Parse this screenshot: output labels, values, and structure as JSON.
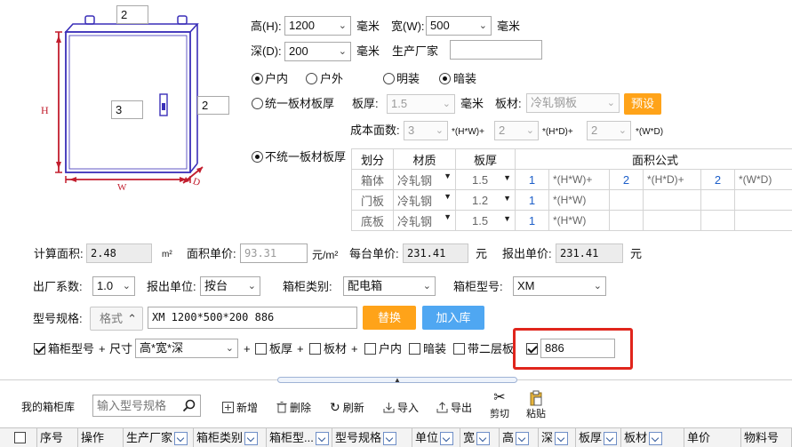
{
  "diagram": {
    "top_value": "2",
    "front_value": "3",
    "side_value": "2",
    "h_label": "H",
    "w_label": "W",
    "d_label": "D"
  },
  "dims": {
    "height_label": "高(H):",
    "height_value": "1200",
    "width_label": "宽(W):",
    "width_value": "500",
    "depth_label": "深(D):",
    "depth_value": "200",
    "unit_mm": "毫米",
    "manufacturer_label": "生产厂家",
    "manufacturer_value": ""
  },
  "install": {
    "indoor": "户内",
    "outdoor": "户外",
    "surface": "明装",
    "concealed": "暗装"
  },
  "uniform": {
    "radio_label": "统一板材板厚",
    "thickness_label": "板厚:",
    "thickness_value": "1.5",
    "unit": "毫米",
    "material_label": "板材:",
    "material_value": "冷轧钢板",
    "preset_button": "预设"
  },
  "cost_faces": {
    "label": "成本面数:",
    "v1": "3",
    "t1": "*(H*W)+",
    "v2": "2",
    "t2": "*(H*D)+",
    "v3": "2",
    "t3": "*(W*D)"
  },
  "nonuniform": {
    "radio_label": "不统一板材板厚",
    "headers": [
      "划分",
      "材质",
      "板厚",
      "面积公式"
    ],
    "rows": [
      {
        "name": "箱体",
        "material": "冷轧钢",
        "thick": "1.5",
        "a": "1",
        "fa": "*(H*W)+",
        "b": "2",
        "fb": "*(H*D)+",
        "c": "2",
        "fc": "*(W*D)"
      },
      {
        "name": "门板",
        "material": "冷轧钢",
        "thick": "1.2",
        "a": "1",
        "fa": "*(H*W)"
      },
      {
        "name": "底板",
        "material": "冷轧钢",
        "thick": "1.5",
        "a": "1",
        "fa": "*(H*W)"
      }
    ]
  },
  "calc": {
    "area_label": "计算面积:",
    "area_value": "2.48",
    "area_unit": "m²",
    "unit_price_label": "面积单价:",
    "unit_price_value": "93.31",
    "unit_price_unit": "元/m²",
    "each_price_label": "每台单价:",
    "each_price_value": "231.41",
    "yuan": "元",
    "quote_price_label": "报出单价:",
    "quote_price_value": "231.41"
  },
  "opts": {
    "factor_label": "出厂系数:",
    "factor_value": "1.0",
    "unit_label": "报出单位:",
    "unit_value": "按台",
    "category_label": "箱柜类别:",
    "category_value": "配电箱",
    "model_label": "箱柜型号:",
    "model_value": "XM"
  },
  "spec": {
    "label": "型号规格:",
    "format_button": "格式",
    "value": "XM 1200*500*200 886",
    "replace_button": "替换",
    "add_button": "加入库"
  },
  "flags": {
    "model": "箱柜型号",
    "plus": "+",
    "size": "尺寸",
    "size_value": "高*宽*深",
    "thick": "板厚",
    "material": "板材",
    "indoor": "户内",
    "concealed": "暗装",
    "second_layer": "带二层板",
    "custom_value": "886"
  },
  "toolbar": {
    "library_label": "我的箱柜库",
    "search_placeholder": "输入型号规格",
    "add": "新增",
    "delete": "删除",
    "refresh": "刷新",
    "import": "导入",
    "export": "导出",
    "cut": "剪切",
    "paste": "粘贴"
  },
  "table_headers": [
    "序号",
    "操作",
    "生产厂家",
    "箱柜类别",
    "箱柜型...",
    "型号规格",
    "单位",
    "宽",
    "高",
    "深",
    "板厚",
    "板材",
    "单价",
    "物料号"
  ],
  "colors": {
    "diagram": "#3a2fb8",
    "dim_red": "#c21e2e",
    "orange": "#ffa319",
    "blue": "#4fa7f2",
    "highlight": "#e0251c"
  }
}
